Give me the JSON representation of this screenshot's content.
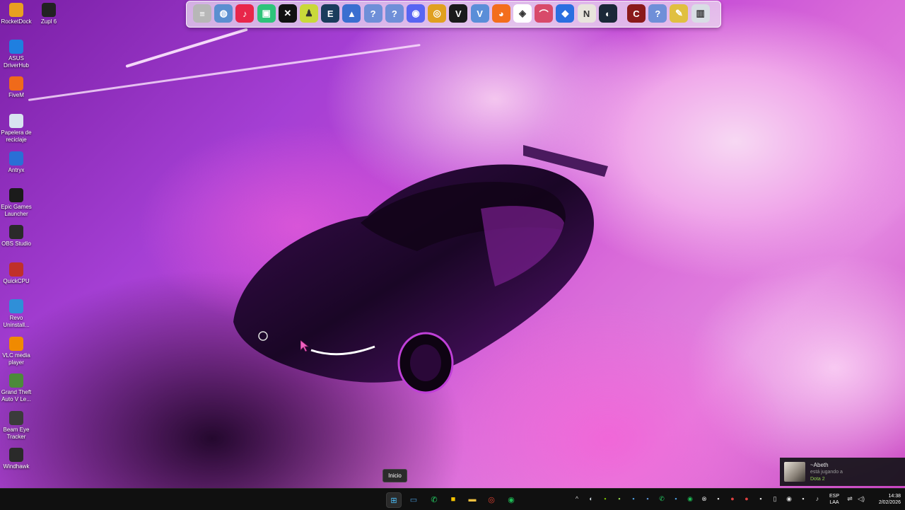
{
  "desktop_icons": [
    {
      "label": "RocketDock",
      "icon": "rocketdock-icon",
      "color": "#e8a020"
    },
    {
      "label": "Zupl 6",
      "icon": "zupl-icon",
      "color": "#222222"
    },
    {
      "label": "ASUS DriverHub",
      "icon": "asus-driverhub-icon",
      "color": "#1f7fe0"
    },
    {
      "label": "FiveM",
      "icon": "fivem-icon",
      "color": "#f06a1a"
    },
    {
      "label": "Papelera de reciclaje",
      "icon": "recycle-bin-icon",
      "color": "#d8e4f0"
    },
    {
      "label": "Antryx",
      "icon": "antryx-icon",
      "color": "#2a6fd6"
    },
    {
      "label": "Epic Games Launcher",
      "icon": "epic-games-icon",
      "color": "#1b1b1b"
    },
    {
      "label": "OBS Studio",
      "icon": "obs-icon",
      "color": "#2a2a2a"
    },
    {
      "label": "QuickCPU",
      "icon": "quickcpu-icon",
      "color": "#c0302a"
    },
    {
      "label": "Revo Uninstall...",
      "icon": "revo-uninstaller-icon",
      "color": "#2f8fd8"
    },
    {
      "label": "VLC media player",
      "icon": "vlc-icon",
      "color": "#f08a00"
    },
    {
      "label": "Grand Theft Auto V Le...",
      "icon": "gta-v-icon",
      "color": "#4c8a3a"
    },
    {
      "label": "Beam Eye Tracker",
      "icon": "beam-eye-tracker-icon",
      "color": "#3b3b3b"
    },
    {
      "label": "Windhawk",
      "icon": "windhawk-icon",
      "color": "#2a2a2a"
    }
  ],
  "dock_items": [
    {
      "icon": "notepad-icon",
      "color": "#b7b7b7",
      "glyph": "≡"
    },
    {
      "icon": "globe-icon",
      "color": "#5b8fd0",
      "glyph": "◍"
    },
    {
      "icon": "tiktok-icon",
      "color": "#e8264a",
      "glyph": "♪"
    },
    {
      "icon": "chat-app-icon",
      "color": "#2ec47a",
      "glyph": "▣"
    },
    {
      "icon": "capcut-icon",
      "color": "#111111",
      "glyph": "✕"
    },
    {
      "icon": "figure-icon",
      "color": "#c9d93a",
      "glyph": "♟"
    },
    {
      "icon": "app-e-icon",
      "color": "#1a3c5c",
      "glyph": "E"
    },
    {
      "icon": "flame-app-icon",
      "color": "#3a6fd0",
      "glyph": "▲"
    },
    {
      "icon": "unknown-app-icon",
      "color": "#6f8fd8",
      "glyph": "?"
    },
    {
      "icon": "unknown-app-icon",
      "color": "#6f8fd8",
      "glyph": "?"
    },
    {
      "icon": "discord-icon",
      "color": "#5865f2",
      "glyph": "◉"
    },
    {
      "icon": "chrome-icon",
      "color": "#e0a020",
      "glyph": "◎"
    },
    {
      "icon": "valorant-icon",
      "color": "#1a1a1a",
      "glyph": "V"
    },
    {
      "icon": "vegas-icon",
      "color": "#5a8ed8",
      "glyph": "V"
    },
    {
      "icon": "firefox-icon",
      "color": "#f36e1c",
      "glyph": "◕"
    },
    {
      "icon": "diamond-app-icon",
      "color": "#ffffff",
      "glyph": "◈"
    },
    {
      "icon": "arc-app-icon",
      "color": "#d84a6a",
      "glyph": "⌒"
    },
    {
      "icon": "roblox-icon",
      "color": "#2a6fe0",
      "glyph": "◆"
    },
    {
      "icon": "notion-icon",
      "color": "#e8e4dc",
      "glyph": "N"
    },
    {
      "icon": "steam-icon",
      "color": "#1b2838",
      "glyph": "◐"
    },
    {
      "icon": "cpu-z-icon",
      "color": "#8a1a1a",
      "glyph": "C"
    },
    {
      "icon": "unknown-app-icon",
      "color": "#6f8fd8",
      "glyph": "?"
    },
    {
      "icon": "tools-app-icon",
      "color": "#e0c040",
      "glyph": "✎"
    },
    {
      "icon": "recycle-bin-icon",
      "color": "#d8dde4",
      "glyph": "▥"
    }
  ],
  "tooltip": {
    "label": "Inicio"
  },
  "notification": {
    "name": "~Abeth",
    "status": "está jugando a",
    "game": "Dota 2"
  },
  "taskbar": {
    "pinned": [
      {
        "icon": "windows-start-icon",
        "color": "#4cc2ff"
      },
      {
        "icon": "terminal-icon",
        "color": "#4a9ad8"
      },
      {
        "icon": "whatsapp-icon",
        "color": "#25d366"
      },
      {
        "icon": "sticky-notes-icon",
        "color": "#f5c400"
      },
      {
        "icon": "file-explorer-icon",
        "color": "#f0c040"
      },
      {
        "icon": "chrome-icon",
        "color": "#e04030"
      },
      {
        "icon": "spotify-icon",
        "color": "#1db954"
      }
    ],
    "tray_icons": [
      "chevron-up-icon",
      "steam-tray-icon",
      "nvidia-icon",
      "tray-app-icon",
      "tray-app-icon",
      "tray-app-icon",
      "whatsapp-tray-icon",
      "tray-app-icon",
      "spotify-tray-icon",
      "xbox-icon",
      "tray-app-icon",
      "microphone-icon",
      "record-icon",
      "tray-app-icon",
      "usb-icon",
      "discord-tray-icon",
      "tray-app-icon",
      "mic-icon"
    ],
    "language": "ESP",
    "layout": "LAA",
    "time": "14:38",
    "date": "2/02/2026"
  }
}
